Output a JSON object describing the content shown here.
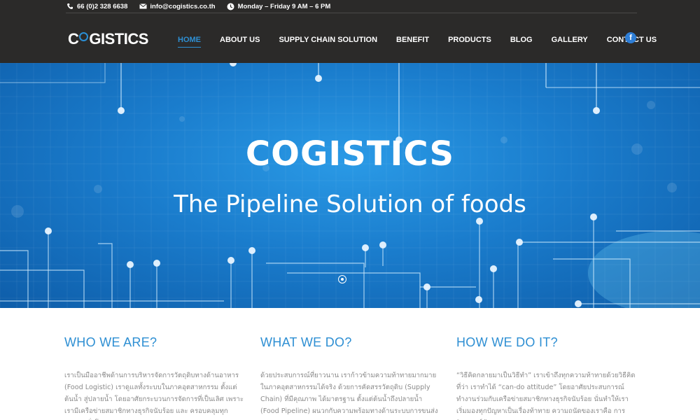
{
  "topbar": {
    "phone": "66 (0)2 328 6638",
    "email": "info@cogistics.co.th",
    "hours": "Monday – Friday 9 AM – 6 PM"
  },
  "logo": {
    "part1": "C",
    "part2": "o",
    "part3": "GISTICS"
  },
  "nav": [
    {
      "label": "HOME",
      "active": true
    },
    {
      "label": "ABOUT US",
      "active": false
    },
    {
      "label": "SUPPLY CHAIN SOLUTION",
      "active": false
    },
    {
      "label": "BENEFIT",
      "active": false
    },
    {
      "label": "PRODUCTS",
      "active": false
    },
    {
      "label": "BLOG",
      "active": false
    },
    {
      "label": "GALLERY",
      "active": false
    },
    {
      "label": "CONTACT US",
      "active": false
    }
  ],
  "social": {
    "facebook": "f"
  },
  "hero": {
    "title": "COGISTICS",
    "subtitle": "The Pipeline Solution of foods"
  },
  "sections": [
    {
      "title": "WHO WE ARE?",
      "body": "เราเป็นมืออาชีพด้านการบริหารจัดการวัตถุดิบทางด้านอาหาร (Food Logistic) เราดูแลทั้งระบบในภาคอุตสาหกรรม ตั้งแต่ต้นน้ำ สู่ปลายน้ำ โดยอาศัยกระบวนการจัดการที่เป็นเลิศ เพราะเรามีเครือข่ายสมาชิกทางธุรกิจนับร้อย และ ครอบคลุมทุกประเทศทั่วโลก"
    },
    {
      "title": "WHAT WE DO?",
      "body": "ด้วยประสบการณ์ที่ยาวนาน เราก้าวข้ามความท้าทายมากมายในภาคอุตสาหกรรมได้จริง ด้วยการคัดสรรวัตถุดิบ (Supply Chain) ที่มีคุณภาพ ได้มาตรฐาน ตั้งแต่ต้นน้ำถึงปลายน้ำ (Food Pipeline) ผนวกกับความพร้อมทางด้านระบบการขนส่งแบบ"
    },
    {
      "title": "HOW WE DO IT?",
      "body": "“วิธีคิดกลายมาเป็นวิธีทำ” เราเข้าถึงทุกความท้าทายด้วยวิธีคิดที่ว่า เราทำได้ “can-do attitude” โดยอาศัยประสบการณ์ทำงานร่วมกับเครือข่ายสมาชิกทางธุรกิจนับร้อย นั่นทำให้เราเริ่มมองทุกปัญหาเป็นเรื่องท้าทาย ความถนัดของเราคือ การวิเคราะห์ข้อมูล"
    }
  ],
  "colors": {
    "header_bg": "#2b2a29",
    "accent": "#2e8fd3",
    "hero_bg": "#1a7ccc"
  }
}
